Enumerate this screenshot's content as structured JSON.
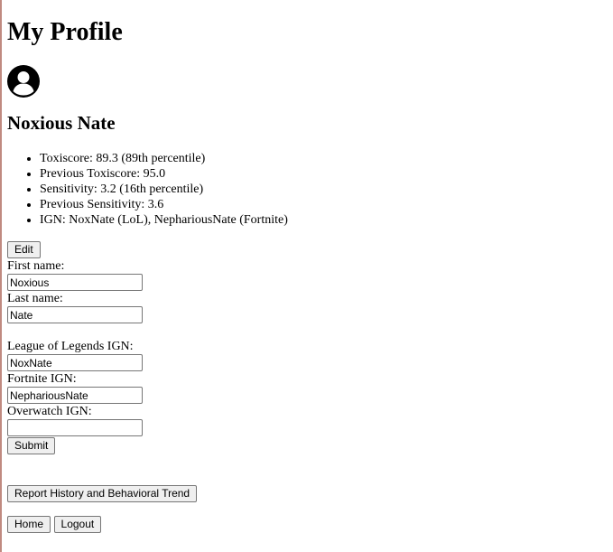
{
  "page": {
    "title": "My Profile"
  },
  "profile": {
    "name": "Noxious Nate",
    "stats": [
      "Toxiscore: 89.3 (89th percentile)",
      "Previous Toxiscore: 95.0",
      "Sensitivity: 3.2 (16th percentile)",
      "Previous Sensitivity: 3.6",
      "IGN: NoxNate (LoL), NephariousNate (Fortnite)"
    ]
  },
  "form": {
    "edit_label": "Edit",
    "first_name": {
      "label": "First name:",
      "value": "Noxious"
    },
    "last_name": {
      "label": "Last name:",
      "value": "Nate"
    },
    "lol_ign": {
      "label": "League of Legends IGN:",
      "value": "NoxNate"
    },
    "fortnite_ign": {
      "label": "Fortnite IGN:",
      "value": "NephariousNate"
    },
    "overwatch_ign": {
      "label": "Overwatch IGN:",
      "value": ""
    },
    "submit_label": "Submit"
  },
  "actions": {
    "report_label": "Report History and Behavioral Trend",
    "home_label": "Home",
    "logout_label": "Logout"
  },
  "icons": {
    "avatar": "user-avatar-icon"
  }
}
